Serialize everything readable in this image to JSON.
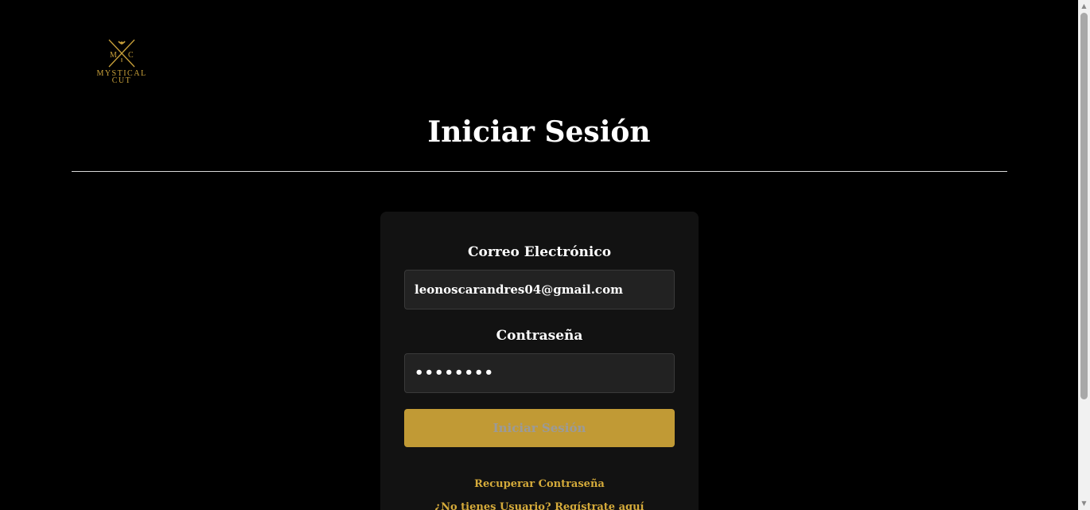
{
  "logo": {
    "monogram_left": "M",
    "monogram_right": "C",
    "line1": "MYSTICAL",
    "line2": "CUT",
    "color": "#c9a13a"
  },
  "page_title": "Iniciar Sesión",
  "form": {
    "email_label": "Correo Electrónico",
    "email_value": "leonoscarandres04@gmail.com",
    "password_label": "Contraseña",
    "password_value": "••••••••",
    "submit_label": "Iniciar Sesión",
    "recover_link": "Recuperar Contraseña",
    "register_link": "¿No tienes Usuario? Regístrate aquí"
  },
  "colors": {
    "background": "#000000",
    "card": "#121212",
    "input": "#222222",
    "accent": "#c19a35",
    "link": "#d4aa3a"
  },
  "scrollbar": {
    "up_arrow": "▲",
    "down_arrow": "▼"
  }
}
